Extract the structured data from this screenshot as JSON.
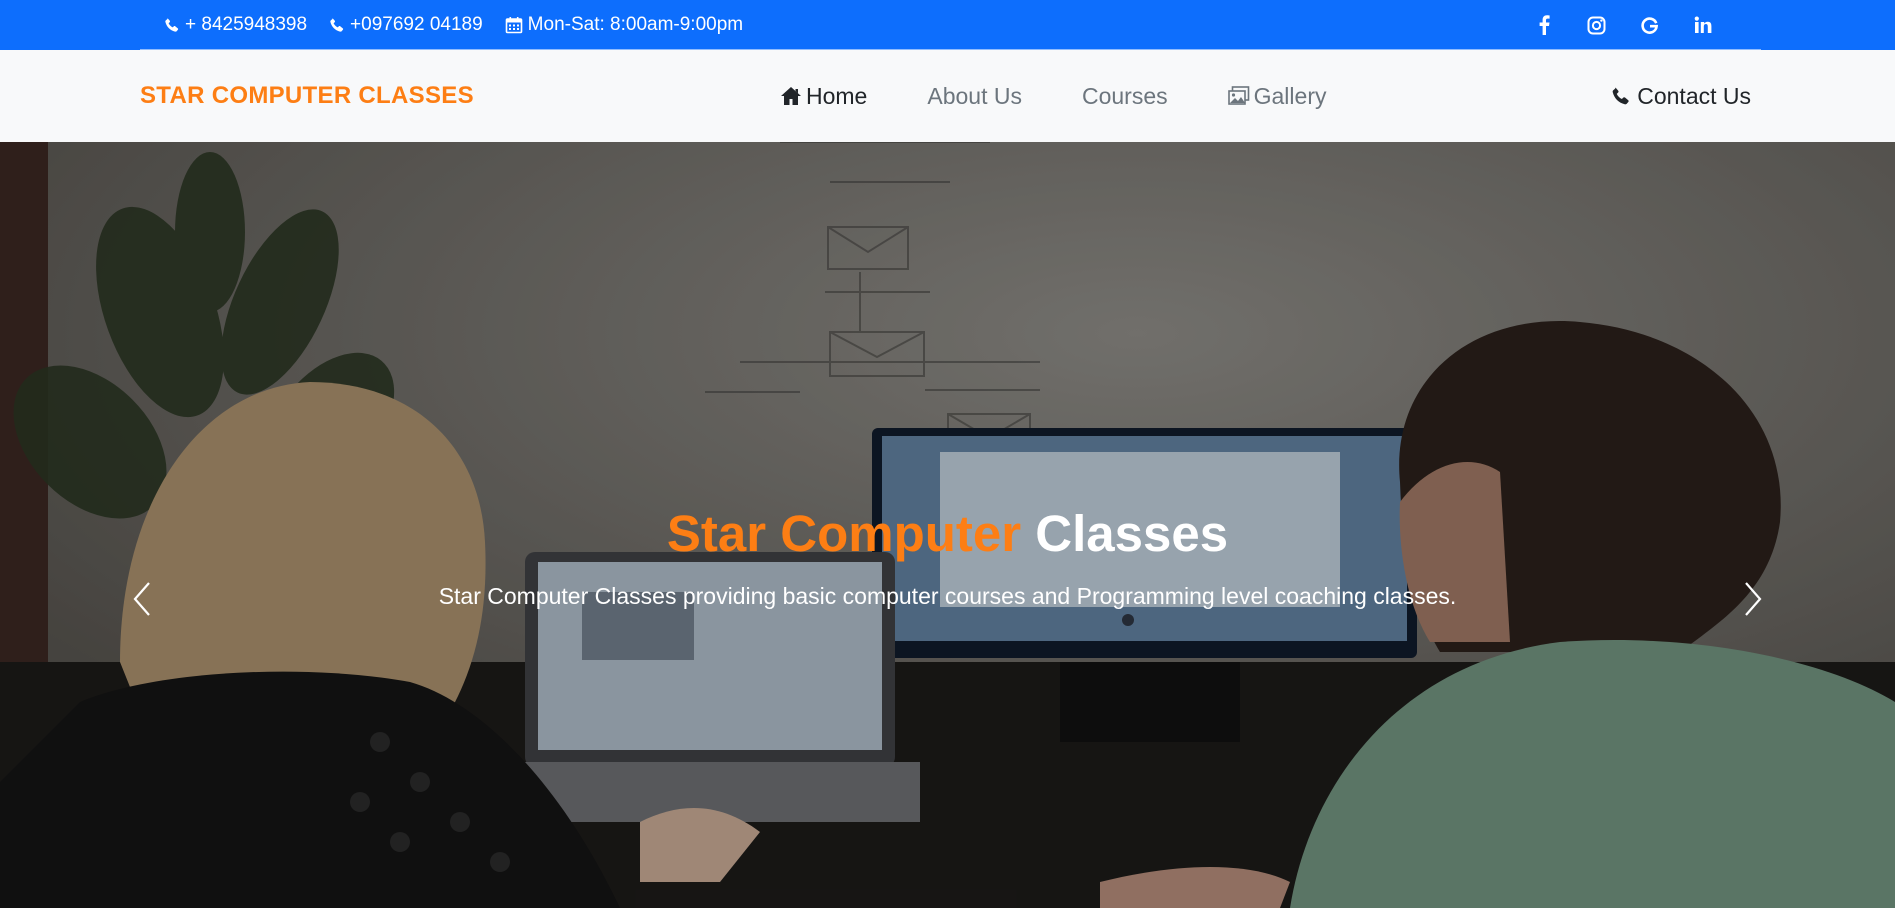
{
  "topbar": {
    "phone1": "+ 8425948398",
    "phone2": "+097692 04189",
    "hours": "Mon-Sat: 8:00am-9:00pm",
    "background": "#0d6efd",
    "social": [
      {
        "icon": "facebook-icon",
        "glyph": "f"
      },
      {
        "icon": "instagram-icon",
        "glyph": ""
      },
      {
        "icon": "google-icon",
        "glyph": "G"
      },
      {
        "icon": "linkedin-icon",
        "glyph": "in"
      }
    ]
  },
  "navbar": {
    "brand": "STAR COMPUTER CLASSES",
    "brand_color": "#fd7e14",
    "links": [
      {
        "label": "Home",
        "icon": "home-icon",
        "active": true
      },
      {
        "label": "About Us",
        "active": false
      },
      {
        "label": "Courses",
        "active": false
      },
      {
        "label": "Gallery",
        "icon": "gallery-icon",
        "active": false
      }
    ],
    "contact": {
      "label": "Contact Us",
      "icon": "phone-icon"
    }
  },
  "hero": {
    "title_accent": "Star Computer",
    "title_rest": "Classes",
    "subtitle": "Star Computer Classes providing basic computer courses and Programming level coaching classes.",
    "prev_icon": "chevron-left-icon",
    "next_icon": "chevron-right-icon"
  }
}
